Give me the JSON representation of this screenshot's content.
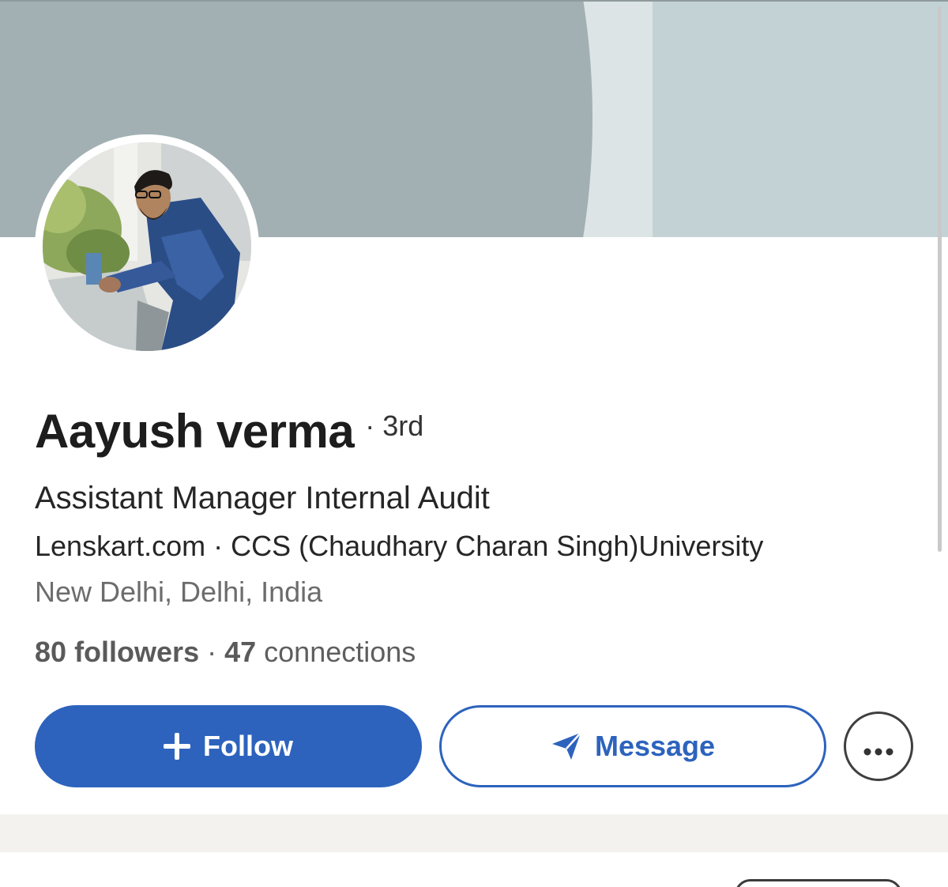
{
  "profile": {
    "name": "Aayush verma",
    "degree": "· 3rd",
    "headline": "Assistant Manager Internal Audit",
    "company_line": "Lenskart.com · CCS (Chaudhary Charan Singh)University",
    "location": "New Delhi, Delhi, India"
  },
  "stats": {
    "followers_count": "80",
    "followers_label": "followers",
    "separator": "·",
    "connections_count": "47",
    "connections_label": "connections"
  },
  "actions": {
    "follow_label": "Follow",
    "message_label": "Message",
    "more_icon": "ellipsis-icon"
  },
  "colors": {
    "accent": "#2d63bd",
    "banner": "#a2b0b3",
    "banner_right": "#c3d2d5"
  }
}
